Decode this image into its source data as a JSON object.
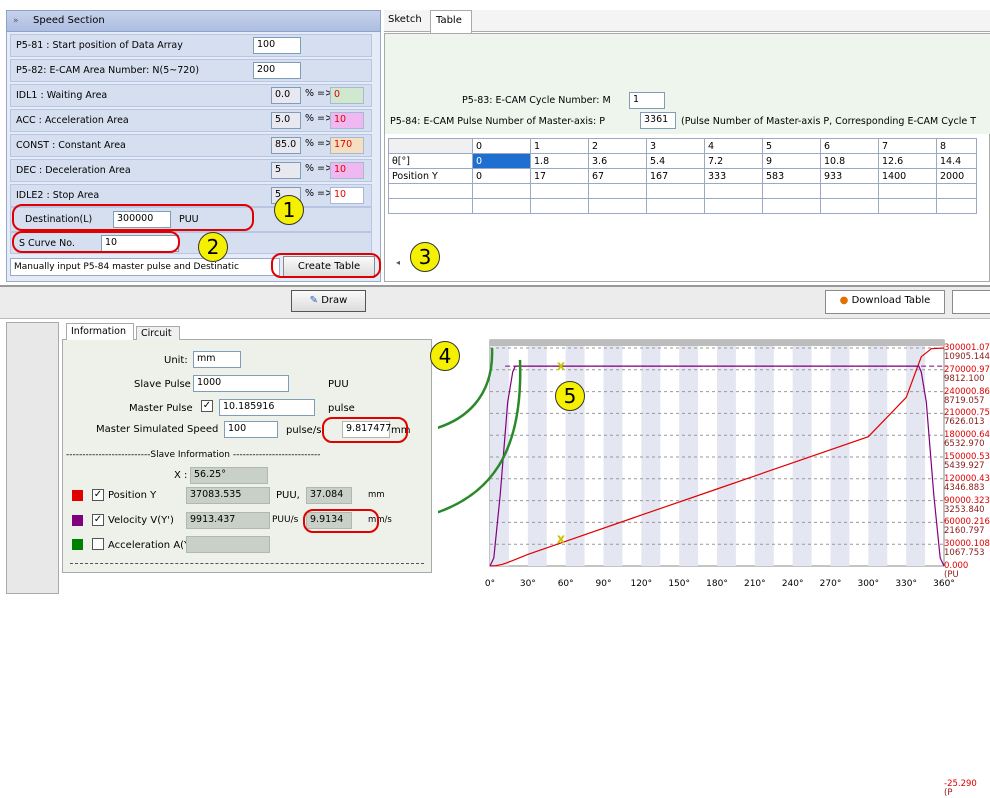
{
  "speed_section": {
    "title": "Speed Section",
    "p581_label": "P5-81 : Start position of Data Array",
    "p581_value": "100",
    "p582_label": "P5-82: E-CAM Area Number: N(5~720)",
    "p582_value": "200",
    "idl1_label": "IDL1 : Waiting Area",
    "idl1_value": "0.0",
    "idl1_pct": "% =>",
    "idl1_result": "0",
    "acc_label": "ACC : Acceleration Area",
    "acc_value": "5.0",
    "acc_pct": "% =>",
    "acc_result": "10",
    "const_label": "CONST : Constant Area",
    "const_value": "85.0",
    "const_pct": "% =>",
    "const_result": "170",
    "dec_label": "DEC : Deceleration Area",
    "dec_value": "5",
    "dec_pct": "% =>",
    "dec_result": "10",
    "idle2_label": "IDLE2 : Stop Area",
    "idle2_value": "5",
    "idle2_pct": "% =>",
    "idle2_result": "10",
    "dest_label": "Destination(L)",
    "dest_value": "300000",
    "dest_unit": "PUU",
    "scurve_label": "S Curve No.",
    "scurve_value": "10",
    "status_text": "Manually input P5-84 master pulse and Destinatic",
    "create_table": "Create Table"
  },
  "badges": [
    "1",
    "2",
    "3",
    "4",
    "5"
  ],
  "top_tabs": [
    "Sketch",
    "Table"
  ],
  "table_panel": {
    "p583_label": "P5-83: E-CAM Cycle Number: M",
    "p583_value": "1",
    "p584_label": "P5-84: E-CAM Pulse Number of Master-axis: P",
    "p584_value": "3361",
    "p584_note": "(Pulse Number of Master-axis P, Corresponding E-CAM Cycle T",
    "header": [
      "0",
      "1",
      "2",
      "3",
      "4",
      "5",
      "6",
      "7",
      "8"
    ],
    "rows": [
      {
        "label": "θ[°]",
        "values": [
          "0",
          "1.8",
          "3.6",
          "5.4",
          "7.2",
          "9",
          "10.8",
          "12.6",
          "14.4"
        ]
      },
      {
        "label": "Position Y",
        "values": [
          "0",
          "17",
          "67",
          "167",
          "333",
          "583",
          "933",
          "1400",
          "2000"
        ]
      }
    ]
  },
  "toolbar": {
    "draw": "Draw",
    "download": "Download Table"
  },
  "info_tabs": [
    "Information",
    "Circuit"
  ],
  "info": {
    "unit_label": "Unit:",
    "unit_value": "mm",
    "slave_label": "Slave Pulse",
    "slave_value": "1000",
    "slave_unit": "PUU",
    "master_label": "Master Pulse",
    "master_value": "10.185916",
    "master_unit": "pulse",
    "speed_label": "Master Simulated Speed",
    "speed_value": "100",
    "speed_unit": "pulse/s",
    "speed_result": "9.817477",
    "speed_result_unit": "mm",
    "slave_info": "--------------------------Slave Information ---------------------------",
    "x_label": "X :",
    "x_value": "56.25°",
    "pos_label": "Position Y",
    "pos_value": "37083.535",
    "pos_unit": "PUU,",
    "pos_mm": "37.084",
    "pos_mm_unit": "mm",
    "vel_label": "Velocity V(Y')",
    "vel_value": "9913.437",
    "vel_unit": "PUU/s",
    "vel_mm": "9.9134",
    "vel_mm_unit": "mm/s",
    "acc_label": "Acceleration A(Y"
  },
  "colors": {
    "position": "#e00000",
    "velocity": "#800080",
    "acceleration": "#008000"
  },
  "chart_data": {
    "type": "line",
    "x_ticks": [
      "0°",
      "30°",
      "60°",
      "90°",
      "120°",
      "150°",
      "180°",
      "210°",
      "240°",
      "270°",
      "300°",
      "330°",
      "360°"
    ],
    "xlim": [
      0,
      360
    ],
    "series": [
      {
        "name": "Position Y",
        "x": [
          0,
          5,
          10,
          18,
          30,
          60,
          120,
          180,
          240,
          300,
          330,
          342,
          350,
          360
        ],
        "y": [
          0,
          600,
          2400,
          7500,
          16000,
          34000,
          70000,
          106000,
          142000,
          178000,
          232000,
          288000,
          299000,
          300000
        ]
      },
      {
        "name": "Velocity V(Y')",
        "x": [
          0,
          3,
          8,
          14,
          18,
          20,
          56.25,
          340,
          342,
          346,
          352,
          357,
          360
        ],
        "y": [
          0,
          400,
          3500,
          8200,
          9700,
          10000,
          10000,
          10000,
          9700,
          8200,
          3500,
          400,
          0
        ]
      }
    ],
    "markers": [
      {
        "x": 56.25,
        "label": "x"
      }
    ],
    "right_axis_labels": [
      [
        "300001.078",
        "10905.144"
      ],
      [
        "270000.970",
        "9812.100"
      ],
      [
        "240000.862",
        "8719.057"
      ],
      [
        "210000.755",
        "7626.013"
      ],
      [
        "180000.647",
        "6532.970"
      ],
      [
        "150000.539",
        "5439.927"
      ],
      [
        "120000.431",
        "4346.883"
      ],
      [
        "90000.323",
        "3253.840"
      ],
      [
        "60000.216",
        "2160.797"
      ],
      [
        "30000.108",
        "1067.753"
      ],
      [
        "0.000",
        "(PU"
      ],
      [
        "-25.290",
        "(P"
      ]
    ]
  }
}
